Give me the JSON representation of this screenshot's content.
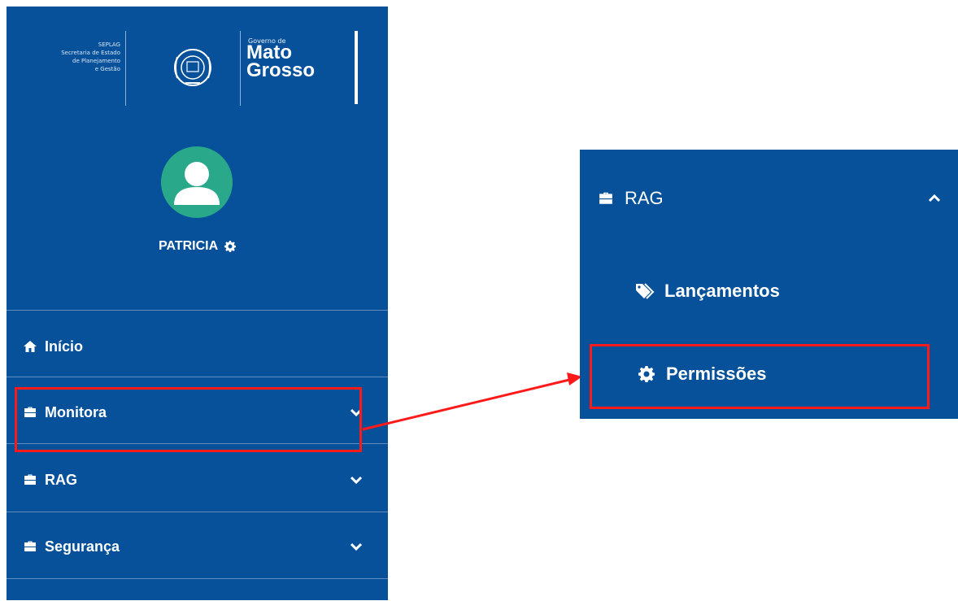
{
  "logo": {
    "org_lines": [
      "SEPLAG",
      "Secretaria de Estado",
      "de Planejamento",
      "e Gestão"
    ],
    "gov_small": "Governo de",
    "gov_line1": "Mato",
    "gov_line2": "Grosso"
  },
  "user": {
    "name": "PATRICIA"
  },
  "sidebar": {
    "items": [
      {
        "label": "Início",
        "icon": "home-icon",
        "has_chevron": false
      },
      {
        "label": "Monitora",
        "icon": "briefcase-icon",
        "has_chevron": true
      },
      {
        "label": "RAG",
        "icon": "briefcase-icon",
        "has_chevron": true
      },
      {
        "label": "Segurança",
        "icon": "briefcase-icon",
        "has_chevron": true
      }
    ]
  },
  "popup": {
    "header": "RAG",
    "items": [
      {
        "label": "Lançamentos",
        "icon": "tags-icon"
      },
      {
        "label": "Permissões",
        "icon": "gear-icon"
      }
    ]
  },
  "colors": {
    "sidebar_bg": "#06519a",
    "avatar_bg": "#2aa88a",
    "highlight": "#ff1a1a"
  }
}
